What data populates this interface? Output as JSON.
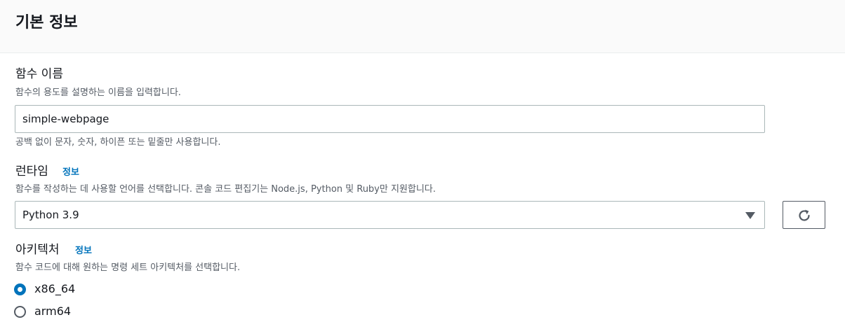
{
  "header": {
    "title": "기본 정보"
  },
  "function_name": {
    "label": "함수 이름",
    "description": "함수의 용도를 설명하는 이름을 입력합니다.",
    "value": "simple-webpage",
    "constraint": "공백 없이 문자, 숫자, 하이픈 또는 밑줄만 사용합니다."
  },
  "runtime": {
    "label": "런타임",
    "info_link": "정보",
    "description": "함수를 작성하는 데 사용할 언어를 선택합니다. 콘솔 코드 편집기는 Node.js, Python 및 Ruby만 지원합니다.",
    "selected": "Python 3.9",
    "caret_icon": "caret-down-icon",
    "refresh_icon": "refresh-icon"
  },
  "architecture": {
    "label": "아키텍처",
    "info_link": "정보",
    "description": "함수 코드에 대해 원하는 명령 세트 아키텍처를 선택합니다.",
    "options": [
      {
        "label": "x86_64",
        "checked": true
      },
      {
        "label": "arm64",
        "checked": false
      }
    ]
  },
  "colors": {
    "accent": "#0073bb",
    "text": "#16191f",
    "secondary_text": "#545b64",
    "header_bg": "#fafafa",
    "border": "#aab7b8"
  }
}
